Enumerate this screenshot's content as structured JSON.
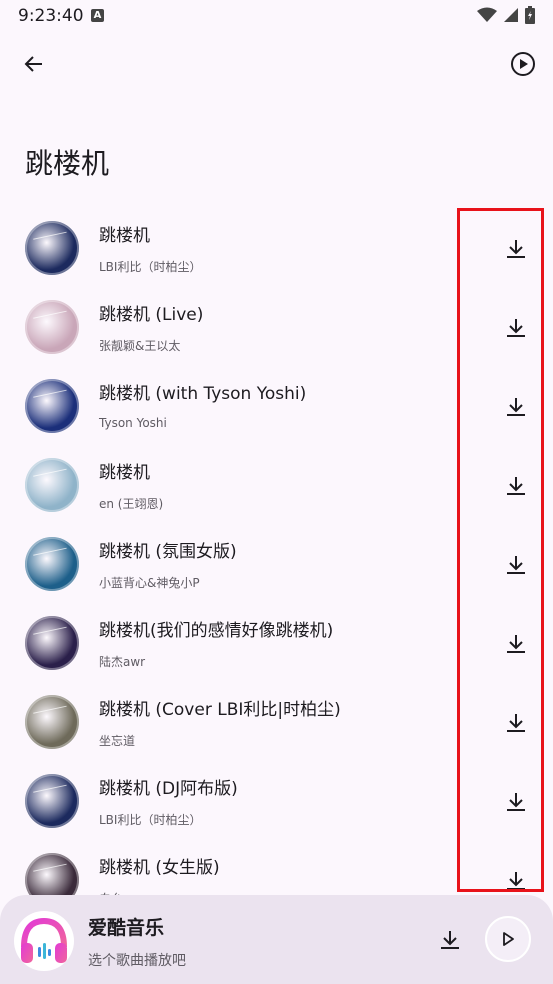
{
  "status_bar": {
    "time": "9:23:40",
    "notification_letter": "A"
  },
  "app_bar": {
    "back_icon": "arrow-left-icon",
    "play_all_icon": "play-circle-icon"
  },
  "page": {
    "title": "跳楼机"
  },
  "songs": [
    {
      "title": "跳楼机",
      "artist": "LBI利比（时柏尘）",
      "cover_color": "#1c2a5e"
    },
    {
      "title": "跳楼机 (Live)",
      "artist": "张靓颖&王以太",
      "cover_color": "#c9a6b8"
    },
    {
      "title": "跳楼机 (with Tyson Yoshi)",
      "artist": "Tyson Yoshi",
      "cover_color": "#1b2f7a"
    },
    {
      "title": "跳楼机",
      "artist": "en (王翊恩)",
      "cover_color": "#8fb3c9"
    },
    {
      "title": "跳楼机 (氛围女版)",
      "artist": "小蓝背心&神兔小P",
      "cover_color": "#1d5f8a"
    },
    {
      "title": "跳楼机(我们的感情好像跳楼机)",
      "artist": "陆杰awr",
      "cover_color": "#2a1f4a"
    },
    {
      "title": "跳楼机 (Cover LBI利比|时柏尘)",
      "artist": "坐忘道",
      "cover_color": "#6e6a5a"
    },
    {
      "title": "跳楼机 (DJ阿布版)",
      "artist": "LBI利比（时柏尘）",
      "cover_color": "#1c2a5e"
    },
    {
      "title": "跳楼机 (女生版)",
      "artist": "白允",
      "cover_color": "#3a2a3a"
    }
  ],
  "download_icon": "download-icon",
  "highlight_color": "#e8121a",
  "mini_player": {
    "title": "爱酷音乐",
    "subtitle": "选个歌曲播放吧",
    "logo_icon": "headphones-logo-icon",
    "download_icon": "download-icon",
    "play_icon": "play-icon"
  }
}
